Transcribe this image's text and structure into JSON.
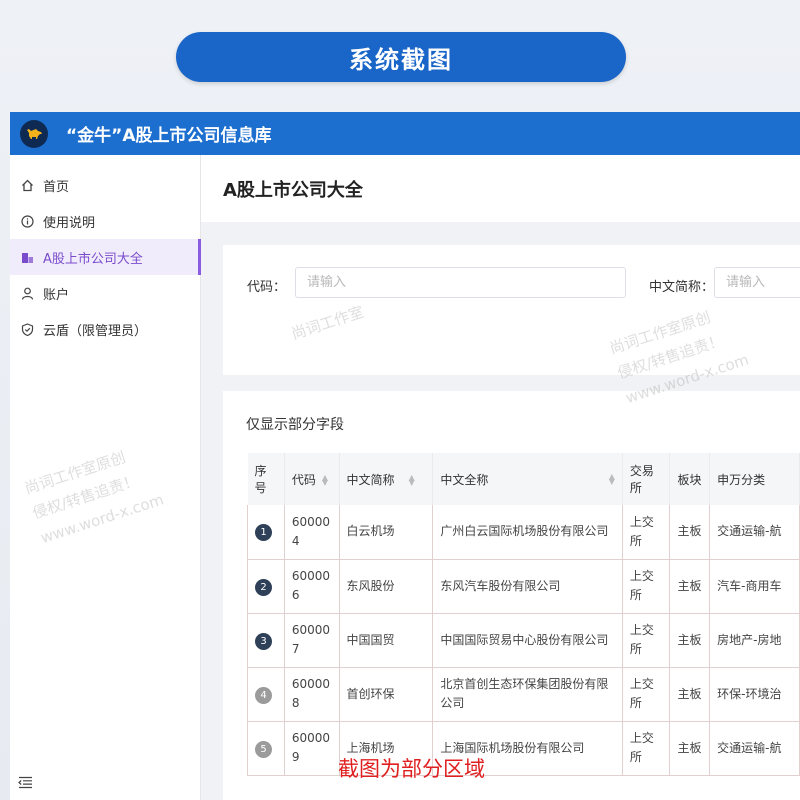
{
  "banner": {
    "title": "系统截图"
  },
  "app": {
    "title": "“金牛”A股上市公司信息库"
  },
  "sidebar": {
    "items": [
      {
        "label": "首页",
        "icon": "home-icon",
        "active": false
      },
      {
        "label": "使用说明",
        "icon": "info-icon",
        "active": false
      },
      {
        "label": "A股上市公司大全",
        "icon": "building-icon",
        "active": true
      },
      {
        "label": "账户",
        "icon": "user-icon",
        "active": false
      },
      {
        "label": "云盾（限管理员）",
        "icon": "shield-icon",
        "active": false
      }
    ]
  },
  "page": {
    "title": "A股上市公司大全"
  },
  "filters": {
    "code_label": "代码：",
    "code_placeholder": "请输入",
    "short_name_label": "中文简称：",
    "short_name_placeholder": "请输入"
  },
  "table": {
    "caption": "仅显示部分字段",
    "headers": [
      "序号",
      "代码",
      "中文简称",
      "中文全称",
      "交易所",
      "板块",
      "申万分类"
    ],
    "rows": [
      {
        "index": "1",
        "code": "600004",
        "short": "白云机场",
        "full": "广州白云国际机场股份有限公司",
        "exchange": "上交所",
        "board": "主板",
        "sw": "交通运输-航"
      },
      {
        "index": "2",
        "code": "600006",
        "short": "东风股份",
        "full": "东风汽车股份有限公司",
        "exchange": "上交所",
        "board": "主板",
        "sw": "汽车-商用车"
      },
      {
        "index": "3",
        "code": "600007",
        "short": "中国国贸",
        "full": "中国国际贸易中心股份有限公司",
        "exchange": "上交所",
        "board": "主板",
        "sw": "房地产-房地"
      },
      {
        "index": "4",
        "code": "600008",
        "short": "首创环保",
        "full": "北京首创生态环保集团股份有限公司",
        "exchange": "上交所",
        "board": "主板",
        "sw": "环保-环境治"
      },
      {
        "index": "5",
        "code": "600009",
        "short": "上海机场",
        "full": "上海国际机场股份有限公司",
        "exchange": "上交所",
        "board": "主板",
        "sw": "交通运输-航"
      }
    ]
  },
  "watermarks": {
    "line1": "尚词工作室原创",
    "line2": "侵权/转售追责！",
    "line3": "www.word-x.com",
    "faint": "尚词工作室"
  },
  "note": "截图为部分区域",
  "colors": {
    "accent": "#1c6fcf",
    "active": "#7a4ccc",
    "note": "#e02020"
  }
}
